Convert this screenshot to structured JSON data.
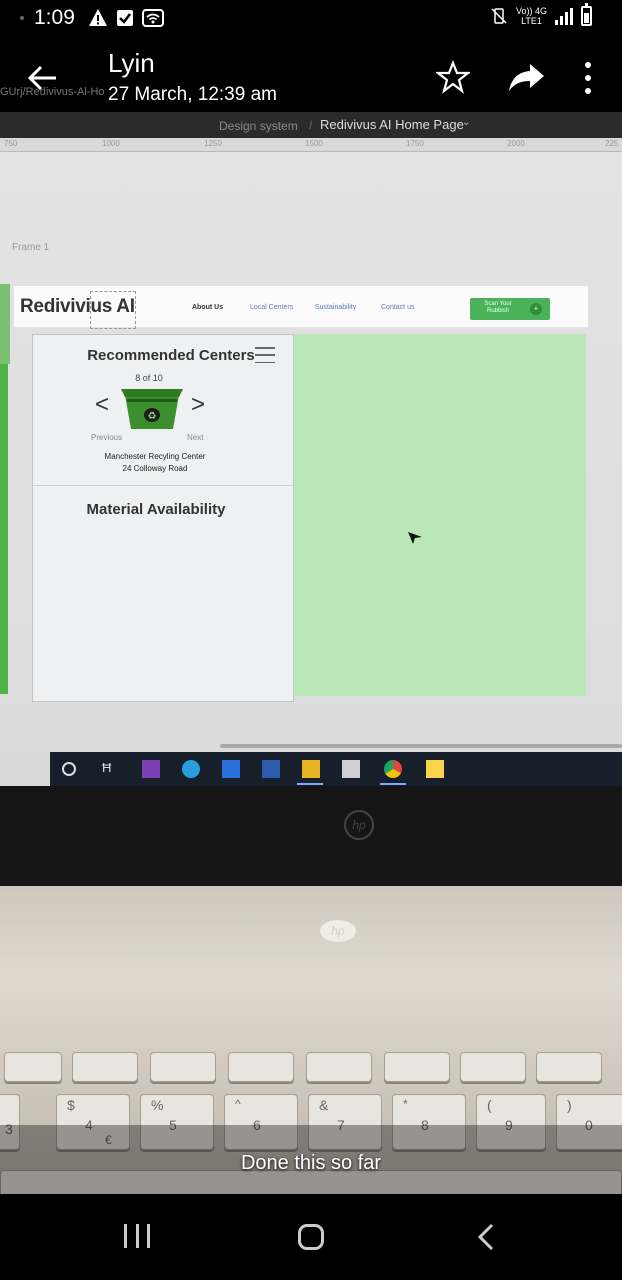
{
  "status_bar": {
    "time": "1:09",
    "network_label_line1": "Vo)) 4G",
    "network_label_line2": "LTE1"
  },
  "header": {
    "sender": "Lyin",
    "date": "27 March, 12:39 am",
    "url_fragment": "GUrj/Redivivus-Al-Ho"
  },
  "figma": {
    "crumb_project": "Design system",
    "crumb_separator": "/",
    "crumb_page": "Redivivus AI Home Page",
    "ruler_ticks": [
      "750",
      "1000",
      "1250",
      "1500",
      "1750",
      "2000",
      "225"
    ],
    "frame_label": "Frame 1"
  },
  "site": {
    "brand": "Redivivius AI",
    "nav": {
      "about": "About Us",
      "local": "Local Centers",
      "sustainability": "Sustainability",
      "contact": "Contact us"
    },
    "scan_button": "Scan Your Rubbish",
    "scan_icon": "+",
    "recommended_title": "Recommended Centers",
    "count": "8 of 10",
    "prev_arrow": "<",
    "next_arrow": ">",
    "prev_label": "Previous",
    "next_label": "Next",
    "center_name": "Manchester Recyling Center",
    "center_address": "24 Colloway Road",
    "material_title": "Material Availability"
  },
  "taskbar": {
    "taskview_glyph": "Ħ"
  },
  "keyboard": {
    "keys": [
      "$",
      "4",
      "€",
      "%",
      "5",
      "^",
      "6",
      "&",
      "7",
      "*",
      "8",
      "(",
      "9",
      ")",
      "0",
      "3"
    ]
  },
  "caption": "Done this so far",
  "colors": {
    "green_area": "#b9e7b8",
    "scan_button": "#4ab35a",
    "panel_bg": "#eef0f1"
  }
}
